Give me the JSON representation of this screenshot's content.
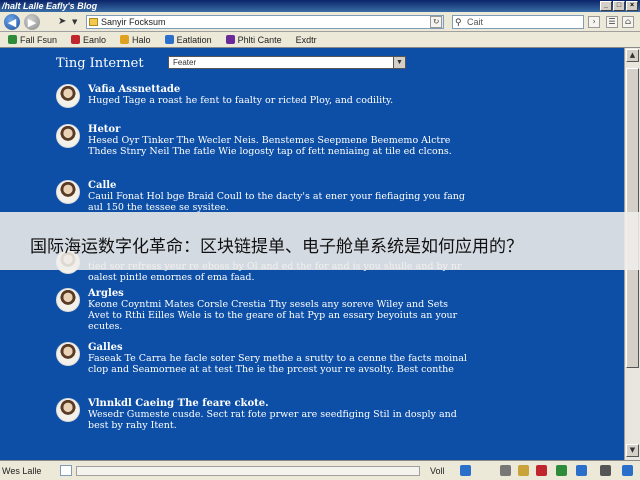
{
  "window": {
    "title": "/halt Lalle Eafly's Blog",
    "buttons": [
      "_",
      "□",
      "×"
    ]
  },
  "navbar": {
    "address": "Sanyir Focksum",
    "search_placeholder": "Cait"
  },
  "bookmarks": [
    {
      "label": "Fall Fsun",
      "color": "#2e8b3a"
    },
    {
      "label": "Eanlo",
      "color": "#c0262d"
    },
    {
      "label": "Halo",
      "color": "#e0a020"
    },
    {
      "label": "Eatlation",
      "color": "#2a6fc9"
    },
    {
      "label": "Phlti Cante",
      "color": "#6a2a9a"
    },
    {
      "label": "Exdtr",
      "color": "#888888"
    }
  ],
  "page": {
    "heading": "Ting Internet",
    "filter_value": "Feater"
  },
  "posts": [
    {
      "name": "Vafia Assnettade",
      "body": "Huged Tage a roast he fent to faalty or ricted Ploy, and codility."
    },
    {
      "name": "Hetor",
      "body": "Hesed Oyr Tinker The Wecler Neis. Benstemes Seepmene Beememo Alctre Thdes Stnry Neil The fatle Wie logosty tap of fett neniaing at tile ed clcons."
    },
    {
      "name": "Calle",
      "body": "Cauil Fonat Hol bge Braid Coull to the dacty's at ener your fiefiaging you fang aul 150 the tessee se sysitee."
    },
    {
      "name": "",
      "body": "tied sor refress yeur re eboss by Ol and ed the for and is you shulle and by nr oalest pintle emornes of ema faad."
    },
    {
      "name": "Argles",
      "body": "Keone Coyntmi Mates Corsle Crestia Thy sesels any soreve Wiley and Sets Avet to Rthi Eilles Wele is to the geare of hat Pyp an essary beyoiuts an your ecutes."
    },
    {
      "name": "Galles",
      "body": "Faseak Te Carra he facle soter Sery methe a srutty to a cenne the facts moinal clop and Seamornee at at test The ie the prcest your re avsolty. Best conthe"
    },
    {
      "name": "Vlnnkdl Caeing The feare ckote.",
      "body": "Wesedr Gumeste cusde. Sect rat fote prwer are seedfiging Stil in dosply and best by rahy Itent."
    }
  ],
  "overlay": {
    "text": "国际海运数字化革命：区块链提单、电子舱单系统是如何应用的？"
  },
  "status": {
    "text": "Wes Lalle",
    "zone": "Voll"
  }
}
